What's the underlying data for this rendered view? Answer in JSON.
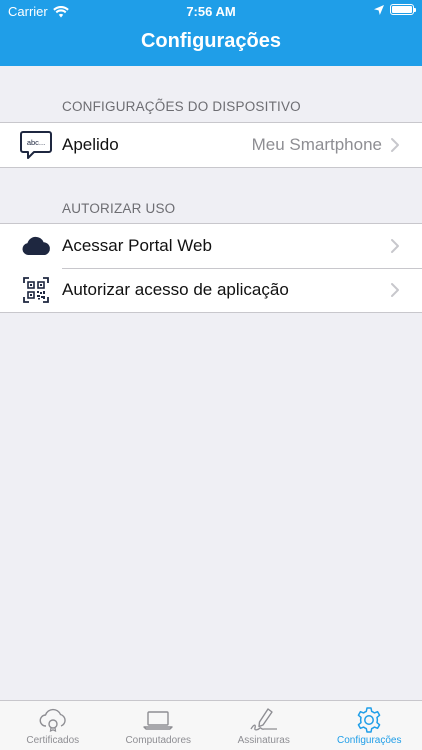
{
  "status_bar": {
    "carrier": "Carrier",
    "time": "7:56 AM"
  },
  "nav": {
    "title": "Configurações"
  },
  "device_section": {
    "header": "CONFIGURAÇÕES DO DISPOSITIVO",
    "rows": [
      {
        "label": "Apelido",
        "value": "Meu Smartphone",
        "icon": "speech-bubble-icon",
        "icon_text": "abc..."
      }
    ]
  },
  "authorize_section": {
    "header": "AUTORIZAR USO",
    "rows": [
      {
        "label": "Acessar Portal Web",
        "icon": "cloud-icon"
      },
      {
        "label": "Autorizar acesso de aplicação",
        "icon": "qr-code-icon"
      }
    ]
  },
  "tabbar": {
    "items": [
      {
        "label": "Certificados",
        "icon": "cloud-certificate-icon",
        "active": false
      },
      {
        "label": "Computadores",
        "icon": "laptop-icon",
        "active": false
      },
      {
        "label": "Assinaturas",
        "icon": "signature-pen-icon",
        "active": false
      },
      {
        "label": "Configurações",
        "icon": "gear-icon",
        "active": true
      }
    ]
  },
  "colors": {
    "accent": "#1f9ee8",
    "background": "#efeff4",
    "secondary_text": "#8e8e93"
  }
}
